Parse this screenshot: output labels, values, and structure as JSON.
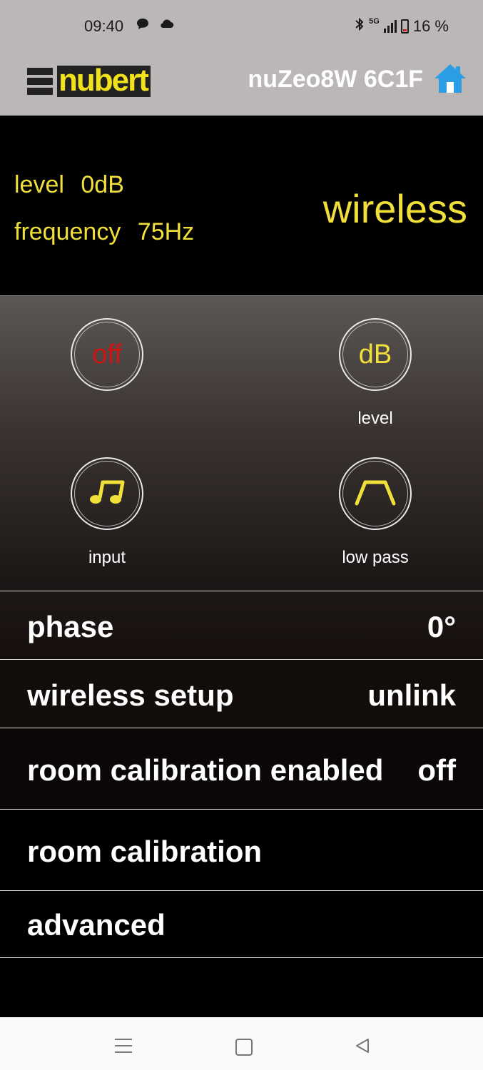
{
  "status_bar": {
    "time": "09:40",
    "network": "5G",
    "battery": "16 %"
  },
  "header": {
    "brand": "nubert",
    "device_name": "nuZeo8W 6C1F",
    "home_icon": "home-icon"
  },
  "info": {
    "level_label": "level",
    "level_value": "0dB",
    "frequency_label": "frequency",
    "frequency_value": "75Hz",
    "mode": "wireless"
  },
  "controls": {
    "power": {
      "text": "off"
    },
    "level": {
      "text": "dB",
      "label": "level"
    },
    "input": {
      "icon": "music-note-icon",
      "label": "input"
    },
    "low_pass": {
      "icon": "low-pass-filter-icon",
      "label": "low pass"
    }
  },
  "settings": {
    "phase": {
      "label": "phase",
      "value": "0°"
    },
    "wireless_setup": {
      "label": "wireless setup",
      "value": "unlink"
    },
    "room_calibration_enabled": {
      "label": "room calibration enabled",
      "value": "off"
    },
    "room_calibration": {
      "label": "room calibration"
    },
    "advanced": {
      "label": "advanced"
    }
  },
  "colors": {
    "accent_yellow": "#f1e03a",
    "off_red": "#d01414",
    "home_blue": "#2a9de4"
  }
}
